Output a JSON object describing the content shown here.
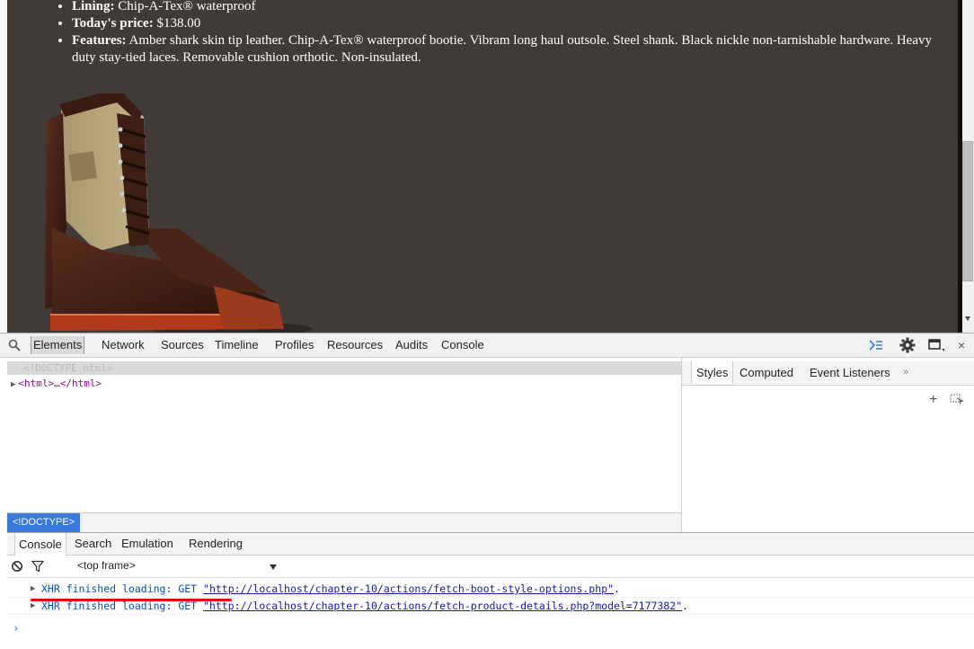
{
  "page": {
    "specs": [
      {
        "label": "Lining:",
        "text": "Chip-A-Tex® waterproof"
      },
      {
        "label": "Today's price:",
        "text": "$138.00"
      },
      {
        "label": "Features:",
        "text": "Amber shark skin tip leather. Chip-A-Tex® waterproof bootie. Vibram long haul outsole. Steel shank. Black nickle non-tarnishable hardware. Heavy duty stay-tied laces. Removable cushion orthotic. Non-insulated."
      }
    ],
    "background_color": "#413b38"
  },
  "devtools": {
    "tabs": [
      "Elements",
      "Network",
      "Sources",
      "Timeline",
      "Profiles",
      "Resources",
      "Audits",
      "Console"
    ],
    "active_tab": "Elements",
    "elements": {
      "doctype": "<!DOCTYPE html>",
      "html_node": "<html>…</html>",
      "breadcrumb": "<!DOCTYPE>"
    },
    "sidebar_tabs": [
      "Styles",
      "Computed",
      "Event Listeners",
      "»"
    ],
    "drawer_tabs": [
      "Console",
      "Search",
      "Emulation",
      "Rendering"
    ],
    "console": {
      "frame": "<top frame>",
      "messages": [
        {
          "label": "XHR finished loading: GET",
          "url": "\"http://localhost/chapter-10/actions/fetch-boot-style-options.php\"",
          "tail": "."
        },
        {
          "label": "XHR finished loading: GET",
          "url": "\"http://localhost/chapter-10/actions/fetch-product-details.php?model=7177382\"",
          "tail": "."
        }
      ],
      "prompt": "›"
    },
    "accent_color": "#3879d9",
    "highlight_color": "#e8000b"
  }
}
